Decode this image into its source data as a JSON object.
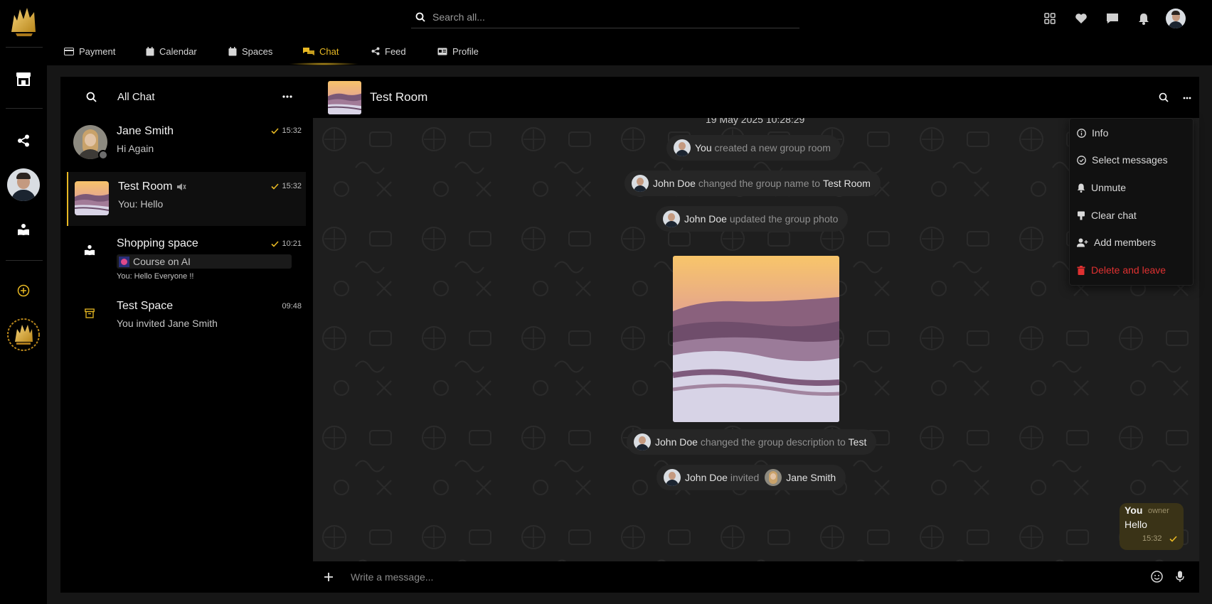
{
  "header": {
    "search_placeholder": "Search all..."
  },
  "tabs": [
    {
      "label": "Payment",
      "icon": "credit-card-icon"
    },
    {
      "label": "Calendar",
      "icon": "calendar-icon"
    },
    {
      "label": "Spaces",
      "icon": "spaces-icon"
    },
    {
      "label": "Chat",
      "icon": "chat-bubbles-icon",
      "active": true
    },
    {
      "label": "Feed",
      "icon": "share-icon"
    },
    {
      "label": "Profile",
      "icon": "id-card-icon"
    }
  ],
  "chat_list": {
    "title": "All Chat",
    "items": [
      {
        "name": "Jane Smith",
        "preview": "Hi Again",
        "time": "15:32",
        "read": true
      },
      {
        "name": "Test Room",
        "preview": "You: Hello",
        "time": "15:32",
        "read": true,
        "muted": true
      },
      {
        "name": "Shopping space",
        "course": "Course on AI",
        "preview": "You: Hello Everyone !!",
        "time": "10:21",
        "read": true
      },
      {
        "name": "Test Space",
        "preview": "You invited Jane Smith",
        "time": "09:48"
      }
    ]
  },
  "chat": {
    "title": "Test Room",
    "date_stamp": "19 May 2025 10:28:29",
    "events": [
      {
        "actor": "You",
        "text": "created a new group room"
      },
      {
        "actor": "John Doe",
        "text": "changed the group name to",
        "target": "Test Room"
      },
      {
        "actor": "John Doe",
        "text": "updated the group photo"
      },
      {
        "actor": "John Doe",
        "text": "changed the group description to",
        "target": "Test"
      },
      {
        "actor": "John Doe",
        "text": "invited",
        "target": "Jane Smith"
      }
    ],
    "own_message": {
      "sender": "You",
      "role": "owner",
      "text": "Hello",
      "time": "15:32"
    },
    "input_placeholder": "Write a message..."
  },
  "menu": {
    "items": [
      {
        "label": "Info",
        "icon": "info-icon"
      },
      {
        "label": "Select messages",
        "icon": "check-circle-icon"
      },
      {
        "label": "Unmute",
        "icon": "bell-icon"
      },
      {
        "label": "Clear chat",
        "icon": "clear-icon"
      },
      {
        "label": "Add members",
        "icon": "add-user-icon"
      },
      {
        "label": "Delete and leave",
        "icon": "trash-icon",
        "danger": true
      }
    ]
  },
  "colors": {
    "accent": "#e8b923",
    "danger": "#e03131",
    "panel": "#000000",
    "chat_bg": "#1e1e1e"
  }
}
